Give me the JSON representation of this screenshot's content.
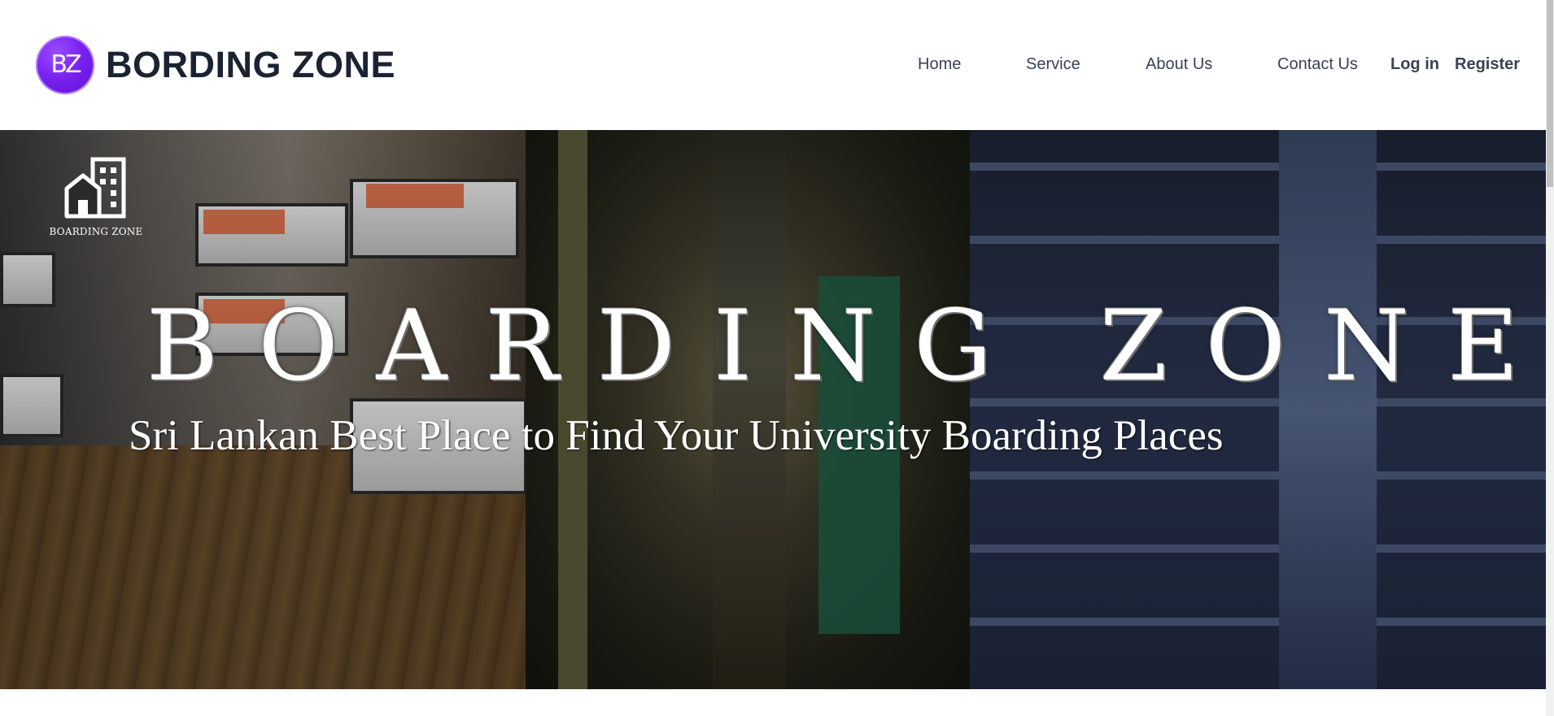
{
  "header": {
    "logo_text": "BZ",
    "brand_name": "BORDING ZONE",
    "nav": [
      {
        "label": "Home"
      },
      {
        "label": "Service"
      },
      {
        "label": "About Us"
      },
      {
        "label": "Contact Us"
      },
      {
        "label": "Log in"
      },
      {
        "label": "Register"
      }
    ]
  },
  "hero": {
    "small_logo_text": "BOARDING ZONE",
    "title": "BOARDING ZONE",
    "subtitle": "Sri Lankan Best Place to Find  Your University Boarding Places",
    "icons": {
      "small_logo": "building-house-icon"
    }
  },
  "colors": {
    "brand_purple": "#7a22f0",
    "brand_text": "#1b2333",
    "nav_text": "#3b4250"
  }
}
